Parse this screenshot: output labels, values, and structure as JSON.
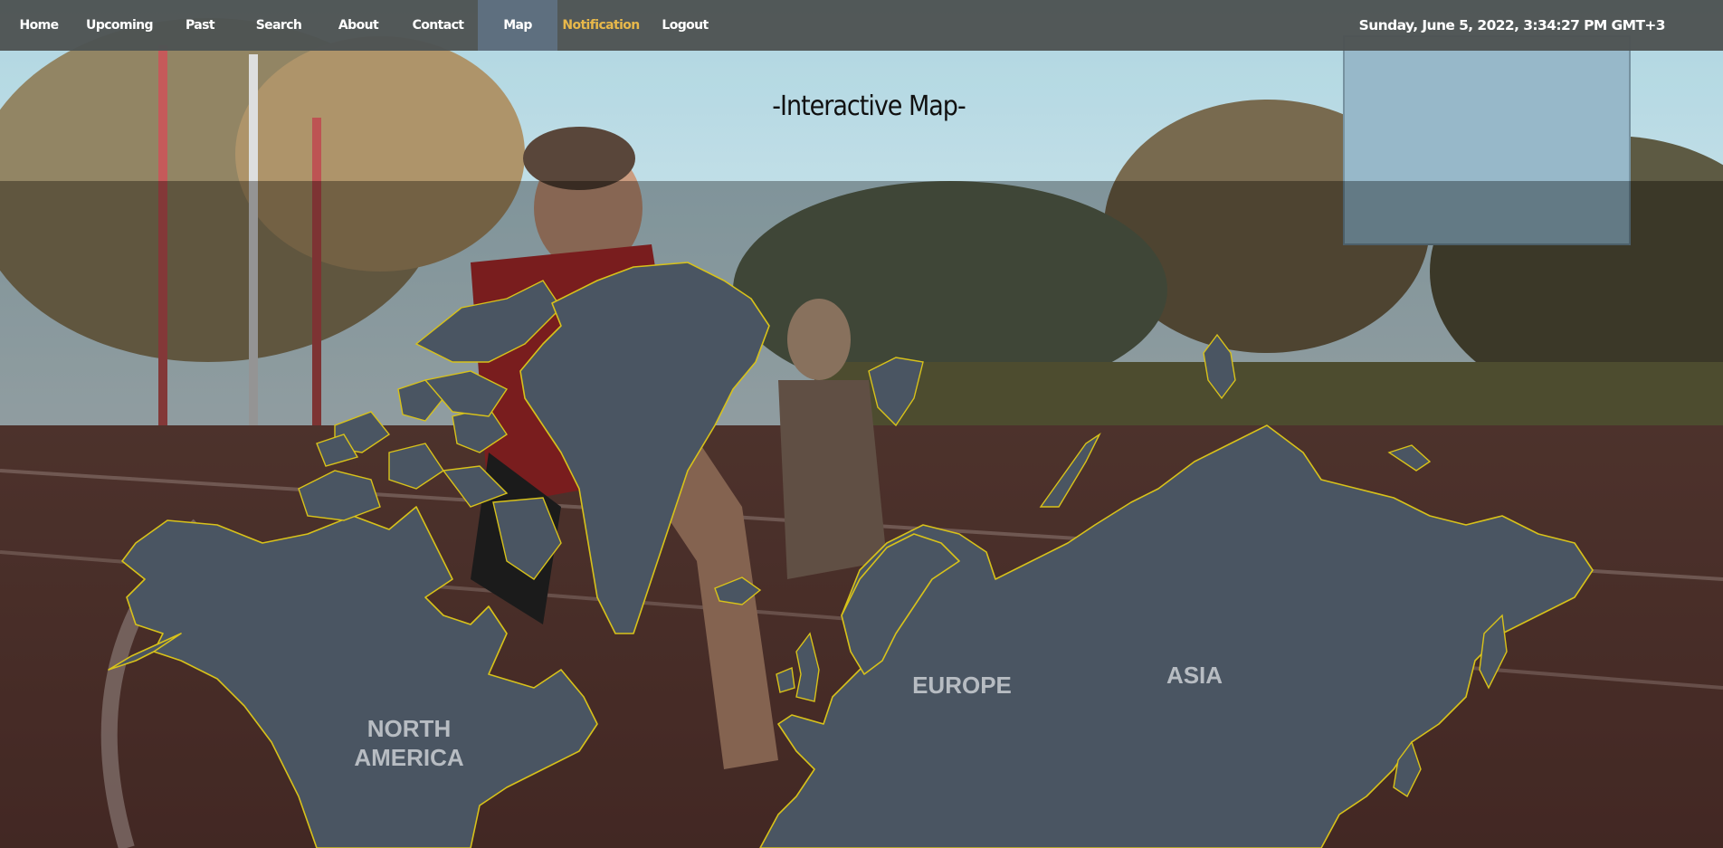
{
  "nav": {
    "items": [
      {
        "label": "Home"
      },
      {
        "label": "Upcoming"
      },
      {
        "label": "Past"
      },
      {
        "label": "Search"
      },
      {
        "label": "About"
      },
      {
        "label": "Contact"
      },
      {
        "label": "Map"
      },
      {
        "label": "Notification"
      },
      {
        "label": "Logout"
      }
    ],
    "active": "Map",
    "clock": "Sunday, June 5, 2022, 3:34:27 PM GMT+3"
  },
  "page": {
    "title": "-Interactive Map-"
  },
  "map": {
    "regions": [
      {
        "label": "NORTH\nAMERICA",
        "line1": "NORTH",
        "line2": "AMERICA"
      },
      {
        "label": "EUROPE"
      },
      {
        "label": "ASIA"
      }
    ]
  },
  "colors": {
    "nav_bg": "#4e5454",
    "nav_active": "#5e6f7f",
    "notification": "#e8b84a",
    "continent_fill": "#4a5562",
    "continent_outline": "#d8c21a",
    "region_label": "#b7bcc2"
  },
  "background": {
    "icon": "athletes-track-photo"
  }
}
